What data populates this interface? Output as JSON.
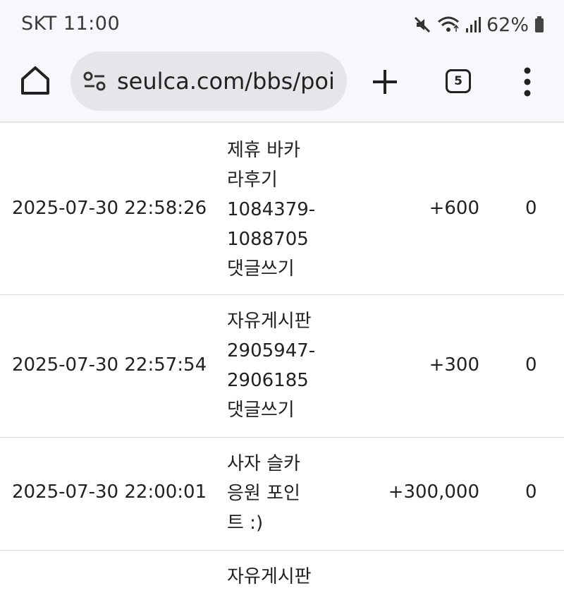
{
  "status_bar": {
    "carrier_time": "SKT 11:00",
    "battery": "62%"
  },
  "browser": {
    "url": "seulca.com/bbs/poi",
    "tab_count": "5"
  },
  "rows": [
    {
      "date": "2025-07-30 22:58:26",
      "desc_lines": [
        "제휴 바카",
        "라후기",
        "1084379-",
        "1088705",
        "댓글쓰기"
      ],
      "point": "+600",
      "use": "0"
    },
    {
      "date": "2025-07-30 22:57:54",
      "desc_lines": [
        "자유게시판",
        "2905947-",
        "2906185",
        "댓글쓰기"
      ],
      "point": "+300",
      "use": "0"
    },
    {
      "date": "2025-07-30 22:00:01",
      "desc_lines": [
        "사자 슬카",
        "응원 포인",
        "트 :)"
      ],
      "point": "+300,000",
      "use": "0"
    },
    {
      "date": "",
      "desc_lines": [
        "자유게시판"
      ],
      "point": "",
      "use": ""
    }
  ]
}
